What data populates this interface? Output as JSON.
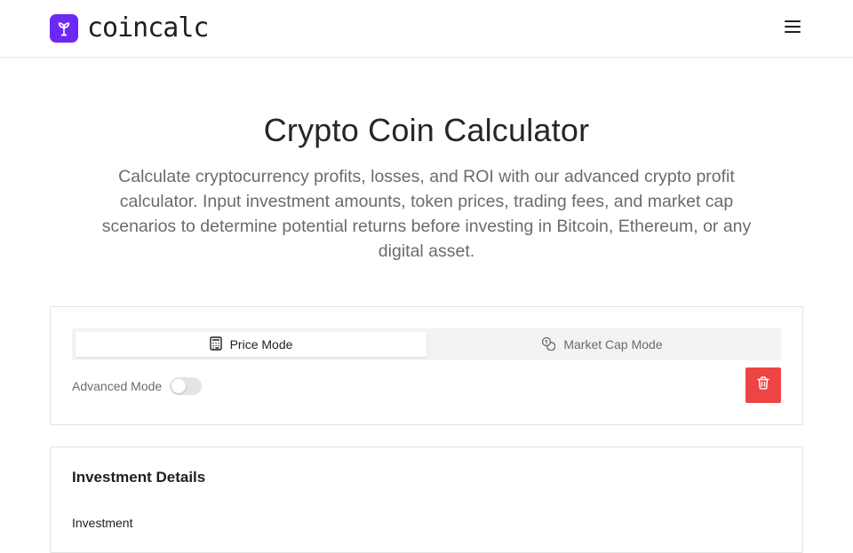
{
  "header": {
    "logo_text": "coincalc",
    "logo_icon": "sprout-icon",
    "menu_icon": "hamburger-menu-icon",
    "brand_color": "#6d28f5"
  },
  "hero": {
    "title": "Crypto Coin Calculator",
    "description": "Calculate cryptocurrency profits, losses, and ROI with our advanced crypto profit calculator. Input investment amounts, token prices, trading fees, and market cap scenarios to determine potential returns before investing in Bitcoin, Ethereum, or any digital asset."
  },
  "mode_card": {
    "tabs": [
      {
        "label": "Price Mode",
        "icon": "calculator-icon",
        "active": true
      },
      {
        "label": "Market Cap Mode",
        "icon": "coins-icon",
        "active": false
      }
    ],
    "advanced_mode_label": "Advanced Mode",
    "advanced_mode_on": false,
    "delete_icon": "trash-icon",
    "delete_color": "#ef4444"
  },
  "investment_card": {
    "title": "Investment Details",
    "field_label": "Investment"
  }
}
